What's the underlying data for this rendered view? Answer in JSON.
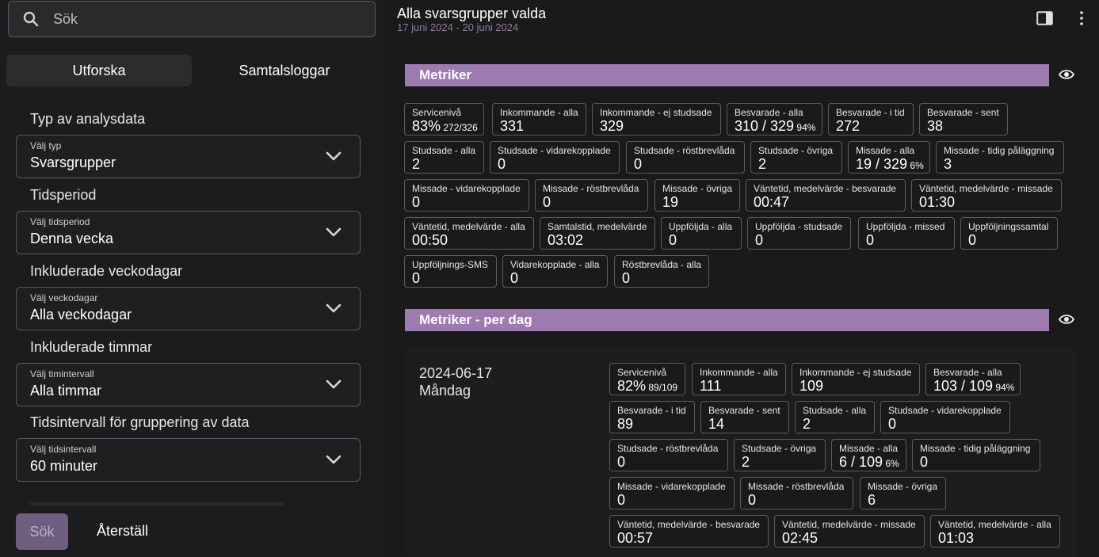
{
  "search": {
    "placeholder": "Sök"
  },
  "tabs": [
    {
      "label": "Utforska"
    },
    {
      "label": "Samtalsloggar"
    }
  ],
  "filters": {
    "type": {
      "section": "Typ av analysdata",
      "small": "Välj typ",
      "value": "Svarsgrupper"
    },
    "period": {
      "section": "Tidsperiod",
      "small": "Välj tidsperiod",
      "value": "Denna vecka"
    },
    "weekdays": {
      "section": "Inkluderade veckodagar",
      "small": "Välj veckodagar",
      "value": "Alla veckodagar"
    },
    "hours": {
      "section": "Inkluderade timmar",
      "small": "Välj timintervall",
      "value": "Alla timmar"
    },
    "interval": {
      "section": "Tidsintervall för gruppering av data",
      "small": "Välj tidsintervall",
      "value": "60 minuter"
    }
  },
  "actions": {
    "search_label": "Sök",
    "reset_label": "Återställ"
  },
  "header": {
    "title": "Alla svarsgrupper valda",
    "subtitle": "17 juni 2024 - 20 juni 2024"
  },
  "metrics": {
    "title": "Metriker",
    "items": [
      {
        "label": "Servicenivå",
        "value": "83%",
        "extra": "272/326"
      },
      {
        "label": "Inkommande - alla",
        "value": "331",
        "extra": ""
      },
      {
        "label": "Inkommande - ej studsade",
        "value": "329",
        "extra": ""
      },
      {
        "label": "Besvarade - alla",
        "value": "310 / 329",
        "extra": "94%"
      },
      {
        "label": "Besvarade - i tid",
        "value": "272",
        "extra": ""
      },
      {
        "label": "Besvarade - sent",
        "value": "38",
        "extra": ""
      },
      {
        "label": "Studsade - alla",
        "value": "2",
        "extra": ""
      },
      {
        "label": "Studsade - vidarekopplade",
        "value": "0",
        "extra": ""
      },
      {
        "label": "Studsade - röstbrevlåda",
        "value": "0",
        "extra": ""
      },
      {
        "label": "Studsade - övriga",
        "value": "2",
        "extra": ""
      },
      {
        "label": "Missade - alla",
        "value": "19 / 329",
        "extra": "6%"
      },
      {
        "label": "Missade - tidig påläggning",
        "value": "3",
        "extra": ""
      },
      {
        "label": "Missade - vidarekopplade",
        "value": "0",
        "extra": ""
      },
      {
        "label": "Missade - röstbrevlåda",
        "value": "0",
        "extra": ""
      },
      {
        "label": "Missade - övriga",
        "value": "19",
        "extra": ""
      },
      {
        "label": "Väntetid, medelvärde - besvarade",
        "value": "00:47",
        "extra": ""
      },
      {
        "label": "Väntetid, medelvärde - missade",
        "value": "01:30",
        "extra": ""
      },
      {
        "label": "Väntetid, medelvärde - alla",
        "value": "00:50",
        "extra": ""
      },
      {
        "label": "Samtalstid, medelvärde",
        "value": "03:02",
        "extra": ""
      },
      {
        "label": "Uppföljda - alla",
        "value": "0",
        "extra": ""
      },
      {
        "label": "Uppföljda - studsade",
        "value": "0",
        "extra": ""
      },
      {
        "label": "Uppföljda - missed",
        "value": "0",
        "extra": ""
      },
      {
        "label": "Uppföljningssamtal",
        "value": "0",
        "extra": ""
      },
      {
        "label": "Uppföljnings-SMS",
        "value": "0",
        "extra": ""
      },
      {
        "label": "Vidarekopplade - alla",
        "value": "0",
        "extra": ""
      },
      {
        "label": "Röstbrevlåda - alla",
        "value": "0",
        "extra": ""
      }
    ]
  },
  "per_day": {
    "title": "Metriker - per dag",
    "date": "2024-06-17",
    "weekday": "Måndag",
    "items": [
      {
        "label": "Servicenivå",
        "value": "82%",
        "extra": "89/109"
      },
      {
        "label": "Inkommande - alla",
        "value": "111",
        "extra": ""
      },
      {
        "label": "Inkommande - ej studsade",
        "value": "109",
        "extra": ""
      },
      {
        "label": "Besvarade - alla",
        "value": "103 / 109",
        "extra": "94%"
      },
      {
        "label": "Besvarade - i tid",
        "value": "89",
        "extra": ""
      },
      {
        "label": "Besvarade - sent",
        "value": "14",
        "extra": ""
      },
      {
        "label": "Studsade - alla",
        "value": "2",
        "extra": ""
      },
      {
        "label": "Studsade - vidarekopplade",
        "value": "0",
        "extra": ""
      },
      {
        "label": "Studsade - röstbrevlåda",
        "value": "0",
        "extra": ""
      },
      {
        "label": "Studsade - övriga",
        "value": "2",
        "extra": ""
      },
      {
        "label": "Missade - alla",
        "value": "6 / 109",
        "extra": "6%"
      },
      {
        "label": "Missade - tidig påläggning",
        "value": "0",
        "extra": ""
      },
      {
        "label": "Missade - vidarekopplade",
        "value": "0",
        "extra": ""
      },
      {
        "label": "Missade - röstbrevlåda",
        "value": "0",
        "extra": ""
      },
      {
        "label": "Missade - övriga",
        "value": "6",
        "extra": ""
      },
      {
        "label": "Väntetid, medelvärde - besvarade",
        "value": "00:57",
        "extra": ""
      },
      {
        "label": "Väntetid, medelvärde - missade",
        "value": "02:45",
        "extra": ""
      },
      {
        "label": "Väntetid, medelvärde - alla",
        "value": "01:03",
        "extra": ""
      }
    ]
  },
  "icons": {
    "search": "search-icon",
    "chevron": "chevron-down-icon",
    "panel": "side-panel-icon",
    "more": "more-vertical-icon",
    "eye": "eye-icon"
  },
  "colors": {
    "banner": "#9d7bb0",
    "accent_muted": "#6e5f80",
    "subtitle": "#8b7a9c"
  }
}
